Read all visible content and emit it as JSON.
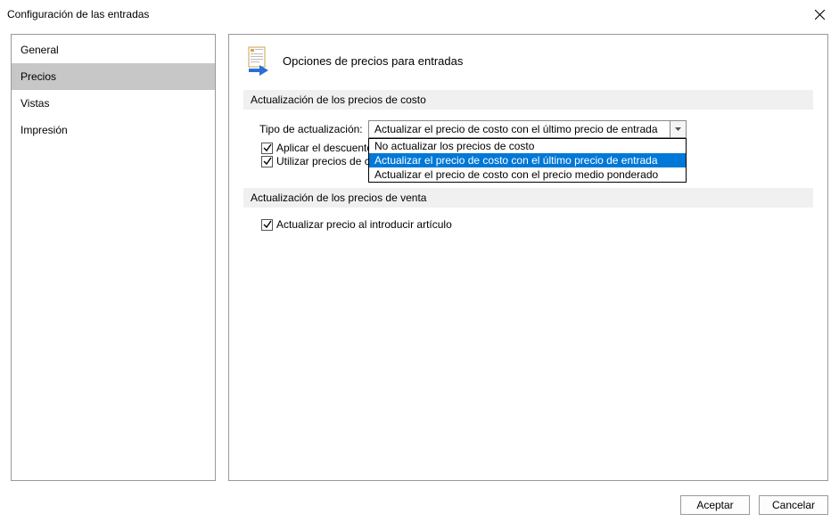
{
  "window": {
    "title": "Configuración de las entradas"
  },
  "sidebar": {
    "items": [
      {
        "label": "General",
        "selected": false
      },
      {
        "label": "Precios",
        "selected": true
      },
      {
        "label": "Vistas",
        "selected": false
      },
      {
        "label": "Impresión",
        "selected": false
      }
    ]
  },
  "main": {
    "header_title": "Opciones de precios para entradas",
    "group1": {
      "title": "Actualización de los precios de costo",
      "field_label": "Tipo de actualización:",
      "dropdown_value": "Actualizar el precio de costo con el último precio de entrada",
      "options": [
        {
          "label": "No actualizar los precios de costo",
          "highlighted": false
        },
        {
          "label": "Actualizar el precio de costo con el último precio de entrada",
          "highlighted": true
        },
        {
          "label": "Actualizar el precio de costo con el precio medio ponderado",
          "highlighted": false
        }
      ],
      "checkbox1": {
        "checked": true,
        "label": "Aplicar el descuento"
      },
      "checkbox2": {
        "checked": true,
        "label": "Utilizar precios de co"
      }
    },
    "group2": {
      "title": "Actualización de los precios de venta",
      "checkbox1": {
        "checked": true,
        "label": "Actualizar precio al introducir artículo"
      }
    }
  },
  "buttons": {
    "accept": "Aceptar",
    "cancel": "Cancelar"
  }
}
